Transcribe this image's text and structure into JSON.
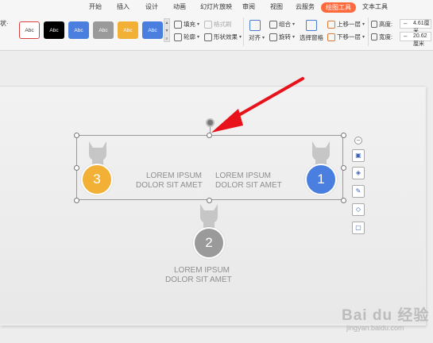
{
  "ribbon": {
    "tabs": [
      "开始",
      "插入",
      "设计",
      "动画",
      "幻灯片放映",
      "审阅",
      "视图",
      "云服务",
      "绘图工具",
      "文本工具"
    ],
    "active_tab": "绘图工具",
    "left_cut_label": "状·",
    "style_gallery": [
      {
        "label": "Abc",
        "bg": "#ffffff",
        "fg": "#333333",
        "border": "#d94040"
      },
      {
        "label": "Abc",
        "bg": "#000000",
        "fg": "#ffffff",
        "border": "#000000"
      },
      {
        "label": "Abc",
        "bg": "#4a7fe0",
        "fg": "#ffffff",
        "border": "#4a7fe0"
      },
      {
        "label": "Abc",
        "bg": "#9a9a9a",
        "fg": "#ffffff",
        "border": "#9a9a9a"
      },
      {
        "label": "Abc",
        "bg": "#f2b136",
        "fg": "#ffffff",
        "border": "#f2b136"
      },
      {
        "label": "Abc",
        "bg": "#4a7fe0",
        "fg": "#ffffff",
        "border": "#4a7fe0"
      }
    ],
    "fill_label": "填充",
    "format_brush_label": "格式刷",
    "outline_label": "轮廓",
    "shape_effect_label": "形状效果",
    "align_label": "对齐",
    "group_label": "组合",
    "rotate_label": "旋转",
    "selection_pane_label": "选择窗格",
    "bring_forward_label": "上移一层",
    "send_backward_label": "下移一层",
    "height_label": "高度:",
    "height_value": "4.61厘米",
    "width_label": "宽度:",
    "width_value": "20.62厘米"
  },
  "slide": {
    "items": [
      {
        "number": "3",
        "color": "#f2b136",
        "text": [
          "LOREM IPSUM",
          "DOLOR SIT AMET"
        ]
      },
      {
        "number": "1",
        "color": "#4a7fe0",
        "text": [
          "LOREM IPSUM",
          "DOLOR SIT AMET"
        ]
      },
      {
        "number": "2",
        "color": "#9a9a9a",
        "text": [
          "LOREM IPSUM",
          "DOLOR SIT AMET"
        ]
      }
    ]
  },
  "side_tools": [
    "minimize-icon",
    "layers-icon",
    "layer-stack-icon",
    "pen-icon",
    "fill-bucket-icon",
    "crop-icon"
  ],
  "annotation_arrow_color": "#e8121b",
  "watermark": {
    "main": "Bai du 经验",
    "sub": "jingyan.baidu.com"
  }
}
